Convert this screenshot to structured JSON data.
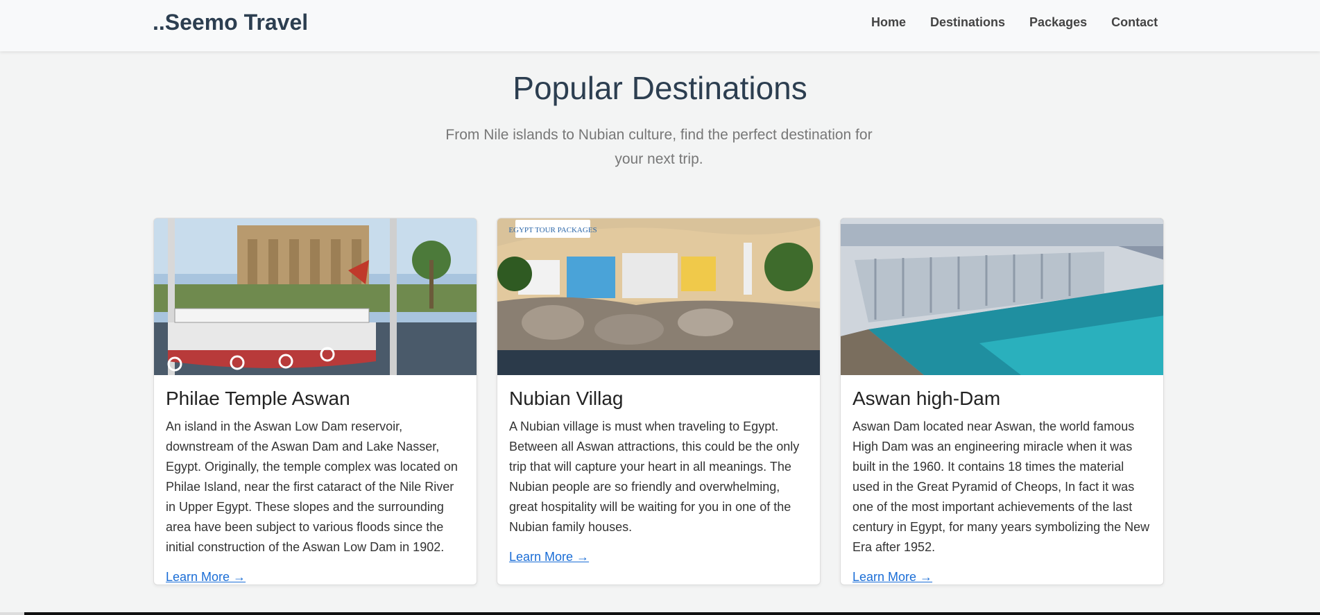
{
  "brand": {
    "name": "..Seemo Travel"
  },
  "nav": {
    "items": [
      {
        "label": "Home"
      },
      {
        "label": "Destinations"
      },
      {
        "label": "Packages"
      },
      {
        "label": "Contact"
      }
    ]
  },
  "hero": {
    "title": "Popular Destinations",
    "subtitle": "From Nile islands to Nubian culture, find the perfect destination for your next trip."
  },
  "cards": [
    {
      "title": "Philae Temple Aswan",
      "text": "An island in the Aswan Low Dam reservoir, downstream of the Aswan Dam and Lake Nasser, Egypt. Originally, the temple complex was located on Philae Island, near the first cataract of the Nile River in Upper Egypt. These slopes and the surrounding area have been subject to various floods since the initial construction of the Aswan Low Dam in 1902.",
      "link": "Learn More →"
    },
    {
      "title": "Nubian Villag",
      "text": "A Nubian village is must when traveling to Egypt. Between all Aswan attractions, this could be the only trip that will capture your heart in all meanings. The Nubian people are so friendly and overwhelming, great hospitality will be waiting for you in one of the Nubian family houses.",
      "link": "Learn More →",
      "image_logo": "EGYPT TOUR PACKAGES"
    },
    {
      "title": "Aswan high-Dam",
      "text": "Aswan Dam located near Aswan, the world famous High Dam was an engineering miracle when it was built in the 1960. It contains 18 times the material used in the Great Pyramid of Cheops, In fact it was one of the most important achievements of the last century in Egypt, for many years symbolizing the New Era after 1952.",
      "link": "Learn More →"
    }
  ]
}
